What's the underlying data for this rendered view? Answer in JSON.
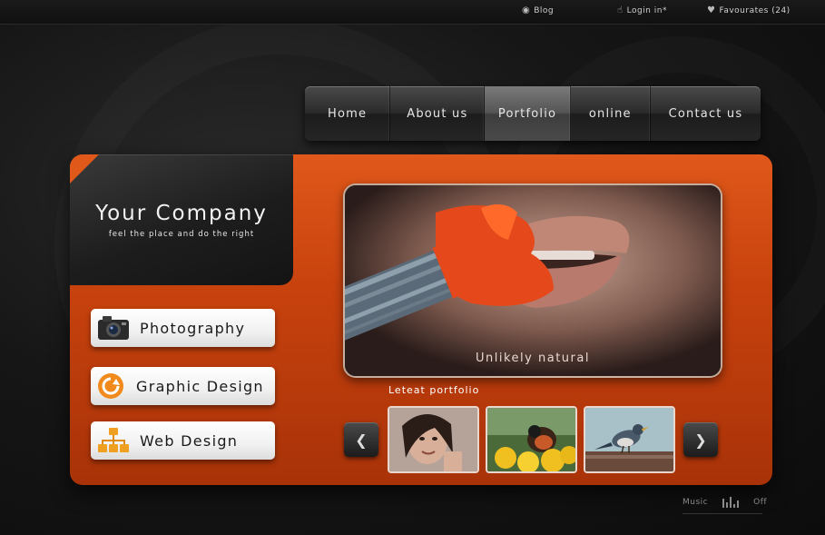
{
  "topbar": {
    "blog_label": "Blog",
    "login_label": "Login in*",
    "favourites_label": "Favourates (24)"
  },
  "nav": {
    "items": [
      {
        "label": "Home"
      },
      {
        "label": "About us"
      },
      {
        "label": "Portfolio",
        "active": true
      },
      {
        "label": "online"
      },
      {
        "label": "Contact us"
      }
    ]
  },
  "company": {
    "title": "Your Company",
    "tagline": "feel the place and do the right"
  },
  "services": [
    {
      "label": "Photography",
      "icon": "camera-icon"
    },
    {
      "label": "Graphic Design",
      "icon": "refresh-icon"
    },
    {
      "label": "Web Design",
      "icon": "sitemap-icon"
    }
  ],
  "hero": {
    "caption": "Unlikely natural"
  },
  "portfolio": {
    "label": "Leteat portfolio",
    "thumbnails": [
      "portrait-thumb",
      "bird-flowers-thumb",
      "bird-fence-thumb"
    ]
  },
  "music": {
    "label": "Music",
    "state": "Off"
  },
  "colors": {
    "accent": "#d9501a",
    "panel_dark": "#1d1d1d",
    "background": "#111111"
  }
}
